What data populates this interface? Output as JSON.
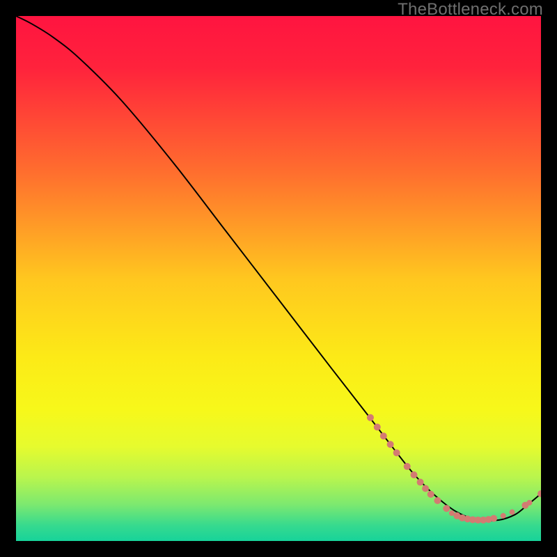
{
  "watermark": "TheBottleneck.com",
  "chart_data": {
    "type": "line",
    "title": "",
    "xlabel": "",
    "ylabel": "",
    "xlim": [
      0,
      100
    ],
    "ylim": [
      0,
      100
    ],
    "gradient_stops": [
      {
        "offset": 0.0,
        "color": "#ff1440"
      },
      {
        "offset": 0.1,
        "color": "#ff233c"
      },
      {
        "offset": 0.3,
        "color": "#ff6f2e"
      },
      {
        "offset": 0.5,
        "color": "#ffc71f"
      },
      {
        "offset": 0.65,
        "color": "#fcea17"
      },
      {
        "offset": 0.75,
        "color": "#f7f81a"
      },
      {
        "offset": 0.82,
        "color": "#e6fb2e"
      },
      {
        "offset": 0.88,
        "color": "#b8f54e"
      },
      {
        "offset": 0.93,
        "color": "#7de96f"
      },
      {
        "offset": 0.97,
        "color": "#37da8e"
      },
      {
        "offset": 1.0,
        "color": "#17d39a"
      }
    ],
    "series": [
      {
        "name": "bottleneck-curve",
        "x": [
          0,
          3,
          7,
          12,
          20,
          30,
          40,
          50,
          60,
          67,
          72,
          76,
          80,
          84,
          88,
          92,
          95,
          97,
          100
        ],
        "y": [
          100,
          98.5,
          96,
          92,
          84,
          72,
          59,
          46,
          33,
          24,
          17.5,
          12.5,
          8.5,
          5.5,
          4,
          4,
          5,
          6.5,
          9
        ]
      }
    ],
    "scatter": {
      "name": "highlight-points",
      "color": "#d37b72",
      "points": [
        {
          "x": 67.5,
          "y": 23.5,
          "r": 5
        },
        {
          "x": 68.8,
          "y": 21.7,
          "r": 5
        },
        {
          "x": 70.0,
          "y": 20.0,
          "r": 5
        },
        {
          "x": 71.3,
          "y": 18.4,
          "r": 5
        },
        {
          "x": 72.5,
          "y": 16.8,
          "r": 5
        },
        {
          "x": 74.5,
          "y": 14.2,
          "r": 5
        },
        {
          "x": 75.8,
          "y": 12.6,
          "r": 5
        },
        {
          "x": 77.0,
          "y": 11.2,
          "r": 5
        },
        {
          "x": 78.0,
          "y": 10.0,
          "r": 5
        },
        {
          "x": 79.0,
          "y": 8.9,
          "r": 5
        },
        {
          "x": 80.3,
          "y": 7.7,
          "r": 5
        },
        {
          "x": 82.0,
          "y": 6.2,
          "r": 5
        },
        {
          "x": 83.0,
          "y": 5.3,
          "r": 4
        },
        {
          "x": 84.0,
          "y": 4.8,
          "r": 5
        },
        {
          "x": 85.0,
          "y": 4.4,
          "r": 5
        },
        {
          "x": 86.0,
          "y": 4.2,
          "r": 5
        },
        {
          "x": 87.0,
          "y": 4.05,
          "r": 5
        },
        {
          "x": 88.0,
          "y": 4.0,
          "r": 5
        },
        {
          "x": 89.0,
          "y": 4.0,
          "r": 5
        },
        {
          "x": 90.0,
          "y": 4.1,
          "r": 5
        },
        {
          "x": 91.0,
          "y": 4.3,
          "r": 5
        },
        {
          "x": 92.8,
          "y": 4.8,
          "r": 4
        },
        {
          "x": 94.5,
          "y": 5.5,
          "r": 4
        },
        {
          "x": 97.0,
          "y": 6.8,
          "r": 5
        },
        {
          "x": 97.8,
          "y": 7.3,
          "r": 4
        },
        {
          "x": 100.0,
          "y": 9.0,
          "r": 5
        }
      ]
    }
  }
}
